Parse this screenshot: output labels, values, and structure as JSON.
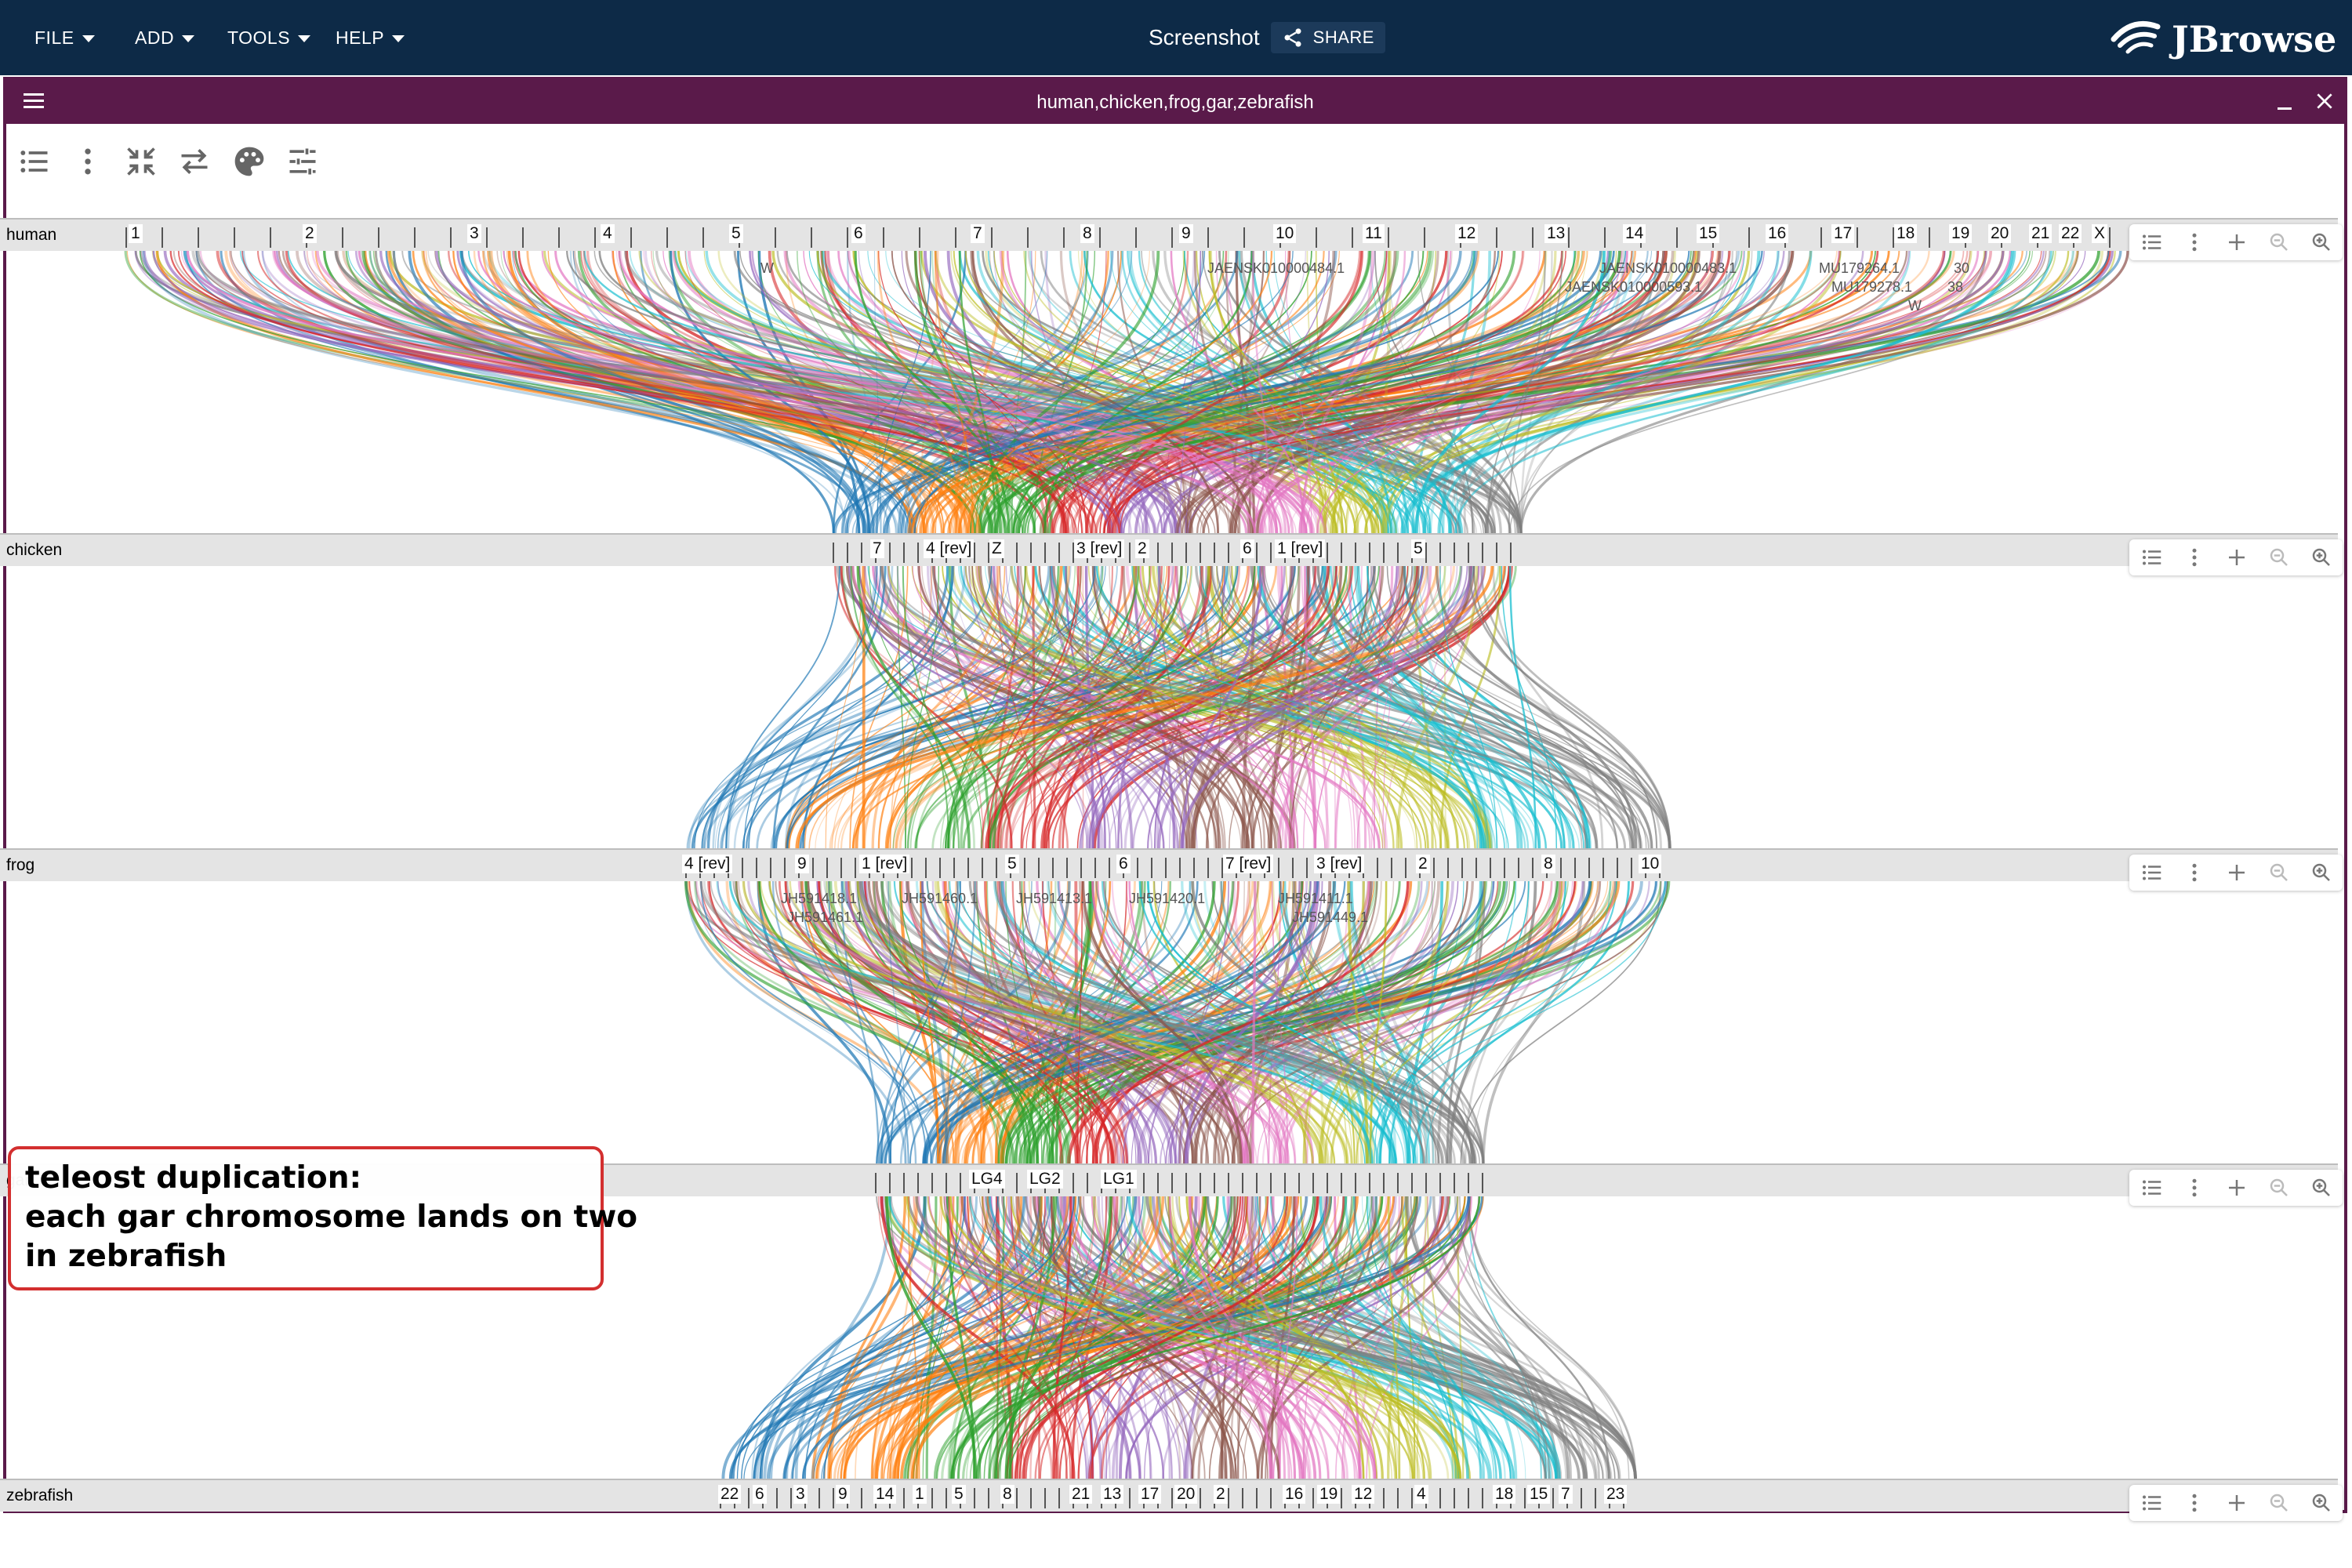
{
  "app": {
    "menus": [
      {
        "label": "FILE"
      },
      {
        "label": "ADD"
      },
      {
        "label": "TOOLS"
      },
      {
        "label": "HELP"
      }
    ],
    "session_title": "Screenshot",
    "share_label": "SHARE",
    "logo_text": "JBrowse"
  },
  "view": {
    "title": "human,chicken,frog,gar,zebrafish",
    "toolbar_icons": [
      "list-icon",
      "more-vert-icon",
      "collapse-icon",
      "swap-icon",
      "palette-icon",
      "tune-icon"
    ]
  },
  "assemblies": [
    {
      "name": "human",
      "segments": [
        "1",
        "2",
        "3",
        "4",
        "5",
        "6",
        "7",
        "8",
        "9",
        "10",
        "11",
        "12",
        "13",
        "14",
        "15",
        "16",
        "17",
        "18",
        "19",
        "20",
        "21",
        "22",
        "X"
      ],
      "annotations": [
        "W",
        "JAENSK010000484.1",
        "JAENSK010000483.1",
        "JAENSK010000593.1",
        "MU179264.1",
        "30",
        "MU179278.1",
        "38",
        "W"
      ]
    },
    {
      "name": "chicken",
      "segments": [
        "7",
        "4 [rev]",
        "Z",
        "3 [rev]",
        "2",
        "6",
        "1 [rev]",
        "5"
      ],
      "annotations": []
    },
    {
      "name": "frog",
      "segments": [
        "4 [rev]",
        "9",
        "1 [rev]",
        "5",
        "6",
        "7 [rev]",
        "3 [rev]",
        "2",
        "8",
        "10"
      ],
      "annotations": [
        "JH591418.1",
        "JH591461.1",
        "JH591460.1",
        "JH591413.1",
        "JH591420.1",
        "JH591411.1",
        "JH591449.1"
      ]
    },
    {
      "name": "gar",
      "segments": [
        "LG4",
        "LG2",
        "LG1"
      ],
      "annotations": []
    },
    {
      "name": "zebrafish",
      "segments": [
        "22",
        "6",
        "3",
        "9",
        "14",
        "1",
        "5",
        "8",
        "21",
        "13",
        "17",
        "20",
        "2",
        "16",
        "19",
        "12",
        "4",
        "18",
        "15",
        "7",
        "23"
      ],
      "annotations": []
    }
  ],
  "callout": {
    "lines": [
      "teleost duplication:",
      "each gar chromosome lands on two",
      "in zebrafish"
    ],
    "border_color": "#d32f2f"
  },
  "colors": {
    "topbar": "#0d2a47",
    "view_header": "#5a1a4a",
    "synteny_palette": [
      "#1f77b4",
      "#ff7f0e",
      "#2ca02c",
      "#d62728",
      "#9467bd",
      "#8c564b",
      "#e377c2",
      "#bcbd22",
      "#17becf",
      "#7f7f7f"
    ]
  }
}
